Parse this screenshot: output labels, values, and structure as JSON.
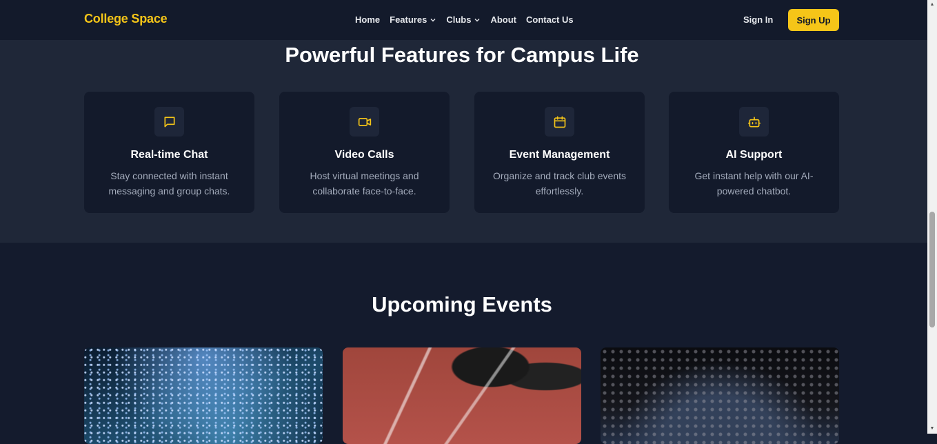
{
  "nav": {
    "brand": "College Space",
    "items": [
      {
        "label": "Home"
      },
      {
        "label": "Features"
      },
      {
        "label": "Clubs"
      },
      {
        "label": "About"
      },
      {
        "label": "Contact Us"
      }
    ],
    "sign_in": "Sign In",
    "sign_up": "Sign Up"
  },
  "features": {
    "title": "Powerful Features for Campus Life",
    "cards": [
      {
        "icon": "chat-icon",
        "title": "Real-time Chat",
        "desc": "Stay connected with instant messaging and group chats."
      },
      {
        "icon": "video-icon",
        "title": "Video Calls",
        "desc": "Host virtual meetings and collaborate face-to-face."
      },
      {
        "icon": "calendar-icon",
        "title": "Event Management",
        "desc": "Organize and track club events effortlessly."
      },
      {
        "icon": "bot-icon",
        "title": "AI Support",
        "desc": "Get instant help with our AI-powered chatbot."
      }
    ]
  },
  "events": {
    "title": "Upcoming Events"
  },
  "colors": {
    "accent": "#f5c518",
    "nav_bg": "#131a2b",
    "section_bg": "#1f2738",
    "page_bg": "#141b2d",
    "card_bg": "#131a2b"
  }
}
